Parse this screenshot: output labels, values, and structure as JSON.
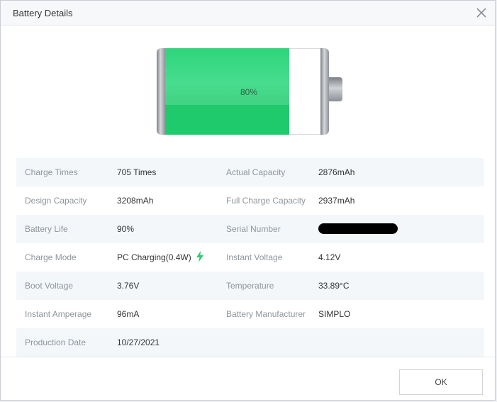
{
  "window": {
    "title": "Battery Details",
    "close_icon": "close-icon"
  },
  "battery": {
    "level_percent": 80,
    "label": "80%",
    "fill_color": "#27cf74"
  },
  "rows": [
    {
      "label_left": "Charge Times",
      "value_left": "705 Times",
      "label_right": "Actual Capacity",
      "value_right": "2876mAh"
    },
    {
      "label_left": "Design Capacity",
      "value_left": "3208mAh",
      "label_right": "Full Charge Capacity",
      "value_right": "2937mAh"
    },
    {
      "label_left": "Battery Life",
      "value_left": "90%",
      "label_right": "Serial Number",
      "value_right": ""
    },
    {
      "label_left": "Charge Mode",
      "value_left": "PC Charging(0.4W)",
      "label_right": "Instant Voltage",
      "value_right": "4.12V"
    },
    {
      "label_left": "Boot Voltage",
      "value_left": "3.76V",
      "label_right": "Temperature",
      "value_right": "33.89°C"
    },
    {
      "label_left": "Instant Amperage",
      "value_left": "96mA",
      "label_right": "Battery Manufacturer",
      "value_right": "SIMPLO"
    },
    {
      "label_left": "Production Date",
      "value_left": "10/27/2021",
      "label_right": "",
      "value_right": ""
    }
  ],
  "charge_icon": "lightning-bolt-icon",
  "charge_icon_color": "#2ecc71",
  "footer": {
    "ok_label": "OK"
  }
}
